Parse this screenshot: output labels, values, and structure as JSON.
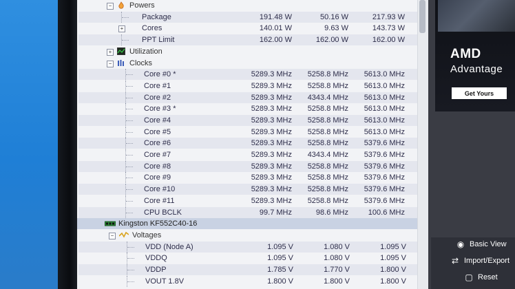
{
  "sensors": {
    "powers_label": "Powers",
    "powers_rows": [
      {
        "label": "Package",
        "cur": "191.48 W",
        "min": "50.16 W",
        "max": "217.93 W",
        "expandable": false
      },
      {
        "label": "Cores",
        "cur": "140.01 W",
        "min": "9.63 W",
        "max": "143.73 W",
        "expandable": true
      },
      {
        "label": "PPT Limit",
        "cur": "162.00 W",
        "min": "162.00 W",
        "max": "162.00 W",
        "expandable": false
      }
    ],
    "utilization_label": "Utilization",
    "clocks_label": "Clocks",
    "clock_rows": [
      {
        "label": "Core #0 *",
        "cur": "5289.3 MHz",
        "min": "5258.8 MHz",
        "max": "5613.0 MHz"
      },
      {
        "label": "Core #1",
        "cur": "5289.3 MHz",
        "min": "5258.8 MHz",
        "max": "5613.0 MHz"
      },
      {
        "label": "Core #2",
        "cur": "5289.3 MHz",
        "min": "4343.4 MHz",
        "max": "5613.0 MHz"
      },
      {
        "label": "Core #3 *",
        "cur": "5289.3 MHz",
        "min": "5258.8 MHz",
        "max": "5613.0 MHz"
      },
      {
        "label": "Core #4",
        "cur": "5289.3 MHz",
        "min": "5258.8 MHz",
        "max": "5613.0 MHz"
      },
      {
        "label": "Core #5",
        "cur": "5289.3 MHz",
        "min": "5258.8 MHz",
        "max": "5613.0 MHz"
      },
      {
        "label": "Core #6",
        "cur": "5289.3 MHz",
        "min": "5258.8 MHz",
        "max": "5379.6 MHz"
      },
      {
        "label": "Core #7",
        "cur": "5289.3 MHz",
        "min": "4343.4 MHz",
        "max": "5379.6 MHz"
      },
      {
        "label": "Core #8",
        "cur": "5289.3 MHz",
        "min": "5258.8 MHz",
        "max": "5379.6 MHz"
      },
      {
        "label": "Core #9",
        "cur": "5289.3 MHz",
        "min": "5258.8 MHz",
        "max": "5379.6 MHz"
      },
      {
        "label": "Core #10",
        "cur": "5289.3 MHz",
        "min": "5258.8 MHz",
        "max": "5379.6 MHz"
      },
      {
        "label": "Core #11",
        "cur": "5289.3 MHz",
        "min": "5258.8 MHz",
        "max": "5379.6 MHz"
      },
      {
        "label": "CPU BCLK",
        "cur": "99.7 MHz",
        "min": "98.6 MHz",
        "max": "100.6 MHz"
      }
    ],
    "memory_device": "Kingston KF552C40-16",
    "voltages_label": "Voltages",
    "voltage_rows": [
      {
        "label": "VDD (Node A)",
        "cur": "1.095 V",
        "min": "1.080 V",
        "max": "1.095 V"
      },
      {
        "label": "VDDQ",
        "cur": "1.095 V",
        "min": "1.080 V",
        "max": "1.095 V"
      },
      {
        "label": "VDDP",
        "cur": "1.785 V",
        "min": "1.770 V",
        "max": "1.800 V"
      },
      {
        "label": "VOUT 1.8V",
        "cur": "1.800 V",
        "min": "1.800 V",
        "max": "1.800 V"
      }
    ]
  },
  "sidebar": {
    "ad_brand": "AMD",
    "ad_tagline": "Advantage",
    "ad_button": "Get Yours",
    "basic_view": "Basic View",
    "import_export": "Import/Export",
    "reset": "Reset"
  },
  "colors": {
    "accent_orange": "#e08a1a",
    "row_alt": "#e4e6ee",
    "selected_row": "#c9d2e3"
  }
}
